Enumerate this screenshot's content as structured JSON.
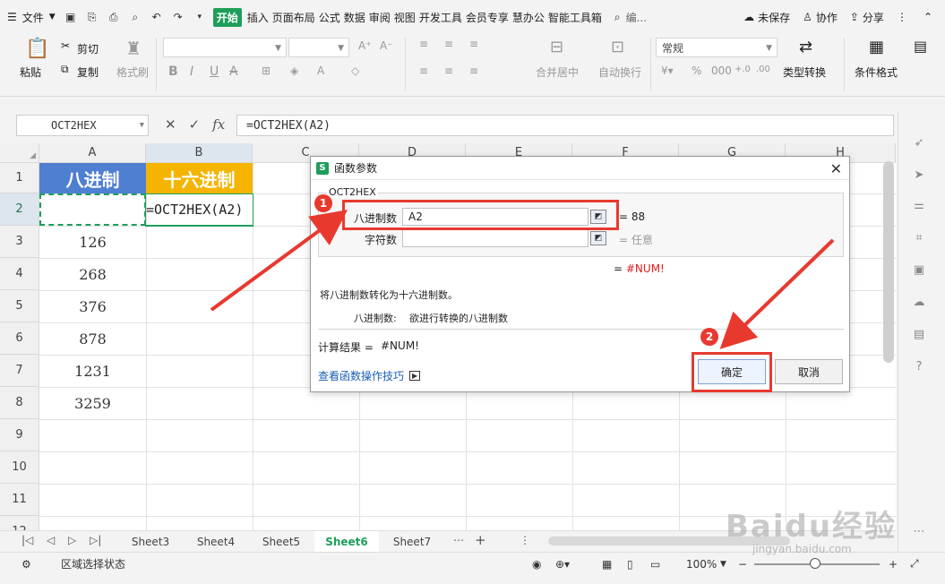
{
  "menubar": {
    "file_menu": "文件",
    "tabs": [
      "开始",
      "插入",
      "页面布局",
      "公式",
      "数据",
      "审阅",
      "视图",
      "开发工具",
      "会员专享",
      "慧办公",
      "智能工具箱"
    ],
    "search": "编...",
    "unsaved": "未保存",
    "collab": "协作",
    "share": "分享"
  },
  "ribbon": {
    "paste": "粘贴",
    "cut": "剪切",
    "copy": "复制",
    "format_painter": "格式刷",
    "merge_center": "合并居中",
    "wrap_text": "自动换行",
    "number_format": "常规",
    "type_convert": "类型转换",
    "cond_format": "条件格式"
  },
  "formula_bar": {
    "name_box": "OCT2HEX",
    "formula": "=OCT2HEX(A2)"
  },
  "grid": {
    "columns": [
      "A",
      "B",
      "C",
      "D",
      "E",
      "F",
      "G",
      "H"
    ],
    "rows": [
      "1",
      "2",
      "3",
      "4",
      "5",
      "6",
      "7",
      "8",
      "9",
      "10",
      "11",
      "12"
    ],
    "header_a": "八进制",
    "header_b": "十六进制",
    "b2_formula": "=OCT2HEX(A2)",
    "values_a": [
      "126",
      "268",
      "376",
      "878",
      "1231",
      "3259"
    ]
  },
  "dialog": {
    "title": "函数参数",
    "function_name": "OCT2HEX",
    "arg1_label": "八进制数",
    "arg1_value": "A2",
    "arg1_result": "88",
    "arg2_label": "字符数",
    "arg2_value": "",
    "arg2_result": "任意",
    "formula_result": "#NUM!",
    "description": "将八进制数转化为十六进制数。",
    "arg_desc_label": "八进制数:",
    "arg_desc_text": "欲进行转换的八进制数",
    "calc_result_label": "计算结果 =",
    "calc_result_value": "#NUM!",
    "help_link": "查看函数操作技巧",
    "ok": "确定",
    "cancel": "取消"
  },
  "annotations": {
    "badge1": "1",
    "badge2": "2"
  },
  "sheets": {
    "tabs": [
      "Sheet3",
      "Sheet4",
      "Sheet5",
      "Sheet6",
      "Sheet7"
    ],
    "active": "Sheet6"
  },
  "status": {
    "mode": "区域选择状态",
    "zoom": "100%"
  },
  "watermark": {
    "main": "Baidu经验",
    "sub": "jingyan.baidu.com"
  },
  "colors": {
    "accent_green": "#1e9e5a",
    "header_blue": "#4f7fd0",
    "header_yellow": "#f5b400",
    "annotation_red": "#e8392f",
    "error_red": "#e02020"
  }
}
